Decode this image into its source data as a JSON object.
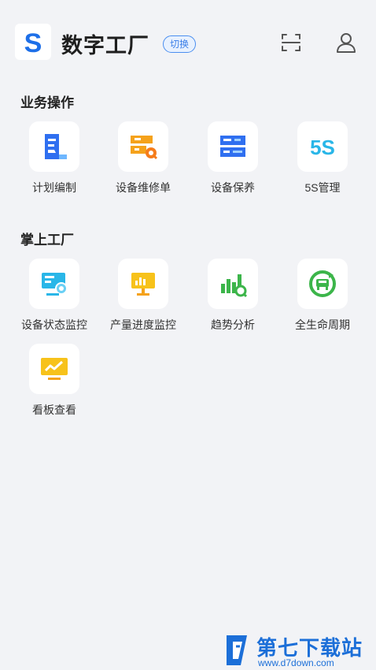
{
  "header": {
    "logo_letter": "S",
    "title": "数字工厂",
    "switch_label": "切换"
  },
  "sections": [
    {
      "title": "业务操作",
      "items": [
        {
          "label": "计划编制",
          "icon": "plan-icon"
        },
        {
          "label": "设备维修单",
          "icon": "repair-order-icon"
        },
        {
          "label": "设备保养",
          "icon": "maintenance-icon"
        },
        {
          "label": "5S管理",
          "icon": "5s-icon"
        }
      ]
    },
    {
      "title": "掌上工厂",
      "items": [
        {
          "label": "设备状态监控",
          "icon": "device-monitor-icon"
        },
        {
          "label": "产量进度监控",
          "icon": "production-monitor-icon"
        },
        {
          "label": "趋势分析",
          "icon": "trend-analysis-icon"
        },
        {
          "label": "全生命周期",
          "icon": "lifecycle-icon"
        },
        {
          "label": "看板查看",
          "icon": "dashboard-icon"
        }
      ]
    }
  ],
  "watermark": {
    "text": "第七下载站",
    "url": "www.d7down.com"
  },
  "colors": {
    "blue": "#2f6ff0",
    "orange": "#f5a21b",
    "cyan": "#29b6e8",
    "green": "#3cb54a",
    "yellow": "#f7c21a"
  }
}
